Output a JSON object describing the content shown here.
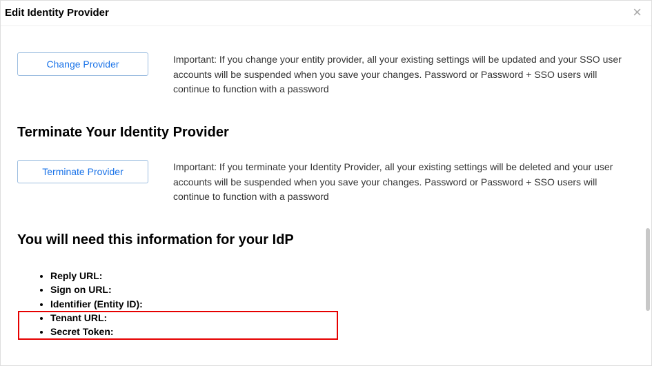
{
  "header": {
    "title": "Edit Identity Provider"
  },
  "changeSection": {
    "buttonLabel": "Change Provider",
    "description": "Important: If you change your entity provider, all your existing settings will be updated and your SSO user accounts will be suspended when you save your changes. Password or Password + SSO users will continue to function with a password"
  },
  "terminateSection": {
    "heading": "Terminate Your Identity Provider",
    "buttonLabel": "Terminate Provider",
    "description": "Important: If you terminate your Identity Provider, all your existing settings will be deleted and your user accounts will be suspended when you save your changes. Password or Password + SSO users will continue to function with a password"
  },
  "infoSection": {
    "heading": "You will need this information for your IdP",
    "items": {
      "replyUrl": "Reply URL:",
      "signOnUrl": "Sign on URL:",
      "identifier": "Identifier (Entity ID):",
      "tenantUrl": "Tenant URL:",
      "secretToken": "Secret Token:"
    }
  }
}
